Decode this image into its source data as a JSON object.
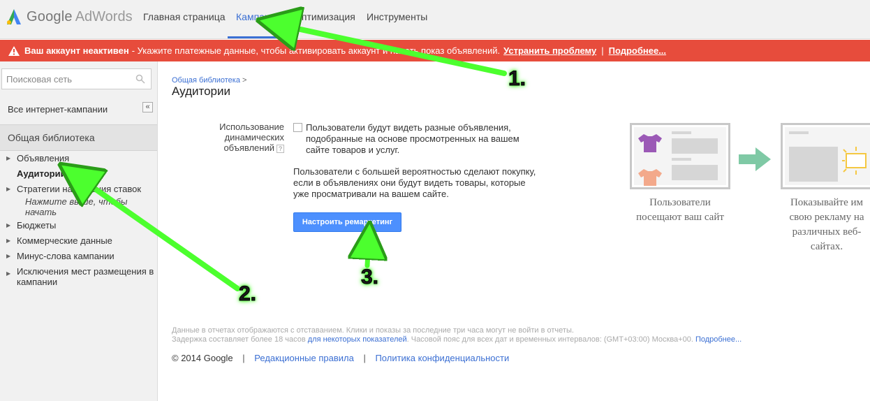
{
  "header": {
    "logo_google": "Google",
    "logo_adwords": "AdWords",
    "tabs": [
      {
        "label": "Главная страница",
        "active": false
      },
      {
        "label": "Кампании",
        "active": true
      },
      {
        "label": "Оптимизация",
        "active": false
      },
      {
        "label": "Инструменты",
        "active": false
      }
    ]
  },
  "alert": {
    "title": "Ваш аккаунт неактивен",
    "message": " - Укажите платежные данные, чтобы активировать аккаунт и начать показ объявлений.",
    "fix_link": "Устранить проблему",
    "sep": "|",
    "more_link": "Подробнее..."
  },
  "sidebar": {
    "search_placeholder": "Поисковая сеть",
    "all_campaigns": "Все интернет-кампании",
    "collapse_symbol": "«",
    "library_header": "Общая библиотека",
    "items": [
      {
        "label": "Объявления"
      },
      {
        "label": "Аудитории"
      },
      {
        "label": "Стратегии назначения ставок"
      },
      {
        "label": "Нажмите выше, чтобы начать"
      },
      {
        "label": "Бюджеты"
      },
      {
        "label": "Коммерческие данные"
      },
      {
        "label": "Минус-слова кампании"
      },
      {
        "label": "Исключения мест размещения в кампании"
      }
    ]
  },
  "main": {
    "breadcrumb": "Общая библиотека",
    "breadcrumb_arrow": ">",
    "title": "Аудитории",
    "dynamic_label": "Использование динамических объявлений",
    "help_symbol": "?",
    "dynamic_desc": "Пользователи будут видеть разные объявления, подобранные на основе просмотренных на вашем сайте товаров и услуг.",
    "remarketing_text": "Пользователи с большей вероятностью сделают покупку, если в объявлениях они будут видеть товары, которые уже просматривали на вашем сайте.",
    "remarketing_button": "Настроить ремаркетинг",
    "illus_1_text": "Пользователи посещают ваш сайт",
    "illus_2_text": "Показывайте им свою рекламу на различных веб-сайтах."
  },
  "footer": {
    "note_line1": "Данные в отчетах отображаются с отставанием. Клики и показы за последние три часа могут не войти в отчеты.",
    "note_line2_a": "Задержка составляет более 18 часов ",
    "note_line2_link": "для некоторых показателей",
    "note_line2_b": ". Часовой пояс для всех дат и временных интервалов: (GMT+03:00) Москва+00. ",
    "note_line2_more": "Подробнее...",
    "copyright": "© 2014 Google",
    "sep": "|",
    "editorial": "Редакционные правила",
    "privacy": "Политика конфиденциальности"
  },
  "annotations": [
    "1.",
    "2.",
    "3."
  ],
  "colors": {
    "accent": "#3b6fd3",
    "alert": "#e74c3c",
    "button": "#4d90fe",
    "annotation_arrow": "#4cff2e"
  }
}
